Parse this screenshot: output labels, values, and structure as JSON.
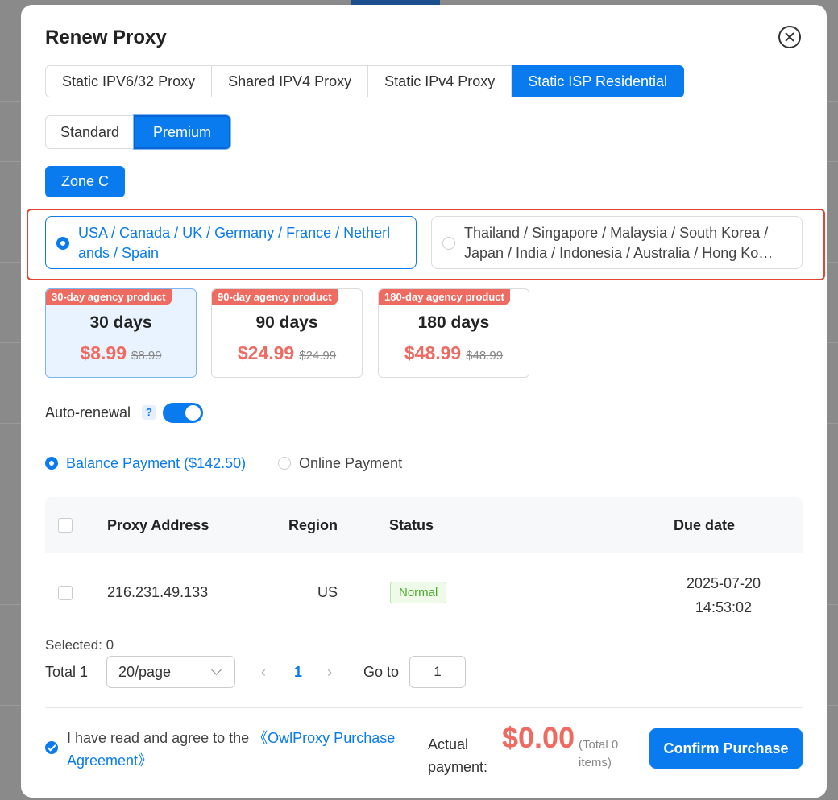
{
  "dialog": {
    "title": "Renew Proxy"
  },
  "proxy_tabs": [
    {
      "label": "Static IPV6/32 Proxy",
      "active": false
    },
    {
      "label": "Shared IPV4 Proxy",
      "active": false
    },
    {
      "label": "Static IPv4 Proxy",
      "active": false
    },
    {
      "label": "Static ISP Residential",
      "active": true
    }
  ],
  "tiers": [
    {
      "label": "Standard",
      "active": false
    },
    {
      "label": "Premium",
      "active": true
    }
  ],
  "zone": {
    "label": "Zone C"
  },
  "regions": [
    {
      "line1": "USA / Canada / UK / Germany / France / Netherl",
      "line2": "ands / Spain",
      "selected": true
    },
    {
      "line1": "Thailand / Singapore / Malaysia / South Korea /",
      "line2": "Japan / India / Indonesia / Australia / Hong Ko…",
      "selected": false
    }
  ],
  "plans": [
    {
      "badge": "30-day agency product",
      "days": "30 days",
      "price": "$8.99",
      "old_price": "$8.99",
      "selected": true
    },
    {
      "badge": "90-day agency product",
      "days": "90 days",
      "price": "$24.99",
      "old_price": "$24.99",
      "selected": false
    },
    {
      "badge": "180-day agency product",
      "days": "180 days",
      "price": "$48.99",
      "old_price": "$48.99",
      "selected": false
    }
  ],
  "auto_renewal": {
    "label": "Auto-renewal",
    "help": "?",
    "enabled": true
  },
  "payment": {
    "balance_label": "Balance Payment ($142.50)",
    "online_label": "Online Payment",
    "selected": "balance"
  },
  "table": {
    "headers": {
      "address": "Proxy Address",
      "region": "Region",
      "status": "Status",
      "due": "Due date"
    },
    "rows": [
      {
        "address": "216.231.49.133",
        "region": "US",
        "status": "Normal",
        "due_date": "2025-07-20",
        "due_time": "14:53:02"
      }
    ]
  },
  "pagination": {
    "selected_text": "Selected: 0",
    "total_text": "Total 1",
    "page_size": "20/page",
    "prev": "‹",
    "next": "›",
    "current_page": "1",
    "goto_label": "Go to",
    "goto_value": "1"
  },
  "footer": {
    "agree_text": "I have read and agree to the ",
    "agree_link": "《OwlProxy Purchase Agreement》",
    "actual_label": "Actual payment:",
    "amount": "$0.00",
    "items_note": "(Total 0 items)",
    "confirm_label": "Confirm Purchase"
  },
  "colors": {
    "accent": "#0a7bef",
    "price": "#ee6b62",
    "highlight_frame": "#e2452f",
    "status_ok": "#4aac2b"
  },
  "icons": [
    "close-icon",
    "question-icon",
    "chevron-down-icon",
    "chevron-left-icon",
    "chevron-right-icon",
    "check-circle-icon"
  ]
}
